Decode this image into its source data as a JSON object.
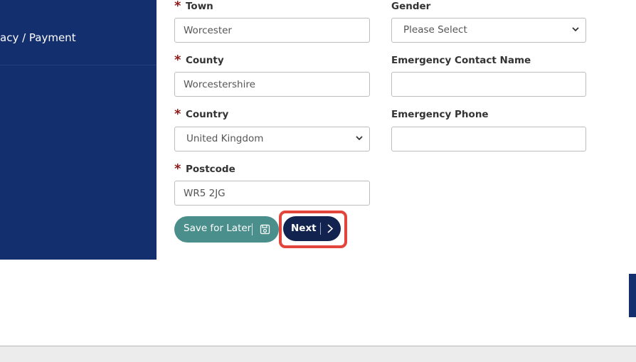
{
  "sidebar": {
    "items": [
      {
        "label": "acy / Payment"
      }
    ]
  },
  "form": {
    "required_marker": "*",
    "town": {
      "label": "Town",
      "value": "Worcester"
    },
    "county": {
      "label": "County",
      "value": "Worcestershire"
    },
    "country": {
      "label": "Country",
      "selected": "United Kingdom"
    },
    "postcode": {
      "label": "Postcode",
      "value": "WR5 2JG"
    },
    "gender": {
      "label": "Gender",
      "selected": "Please Select"
    },
    "emergency_contact_name": {
      "label": "Emergency Contact Name",
      "value": ""
    },
    "emergency_phone": {
      "label": "Emergency Phone",
      "value": ""
    }
  },
  "actions": {
    "save_label": "Save for Later",
    "next_label": "Next",
    "highlight_color": "#e3453a"
  },
  "colors": {
    "sidebar": "#142f6e",
    "save_button": "#4a8f8c",
    "next_button": "#13234f",
    "required": "#8b1a1a"
  }
}
